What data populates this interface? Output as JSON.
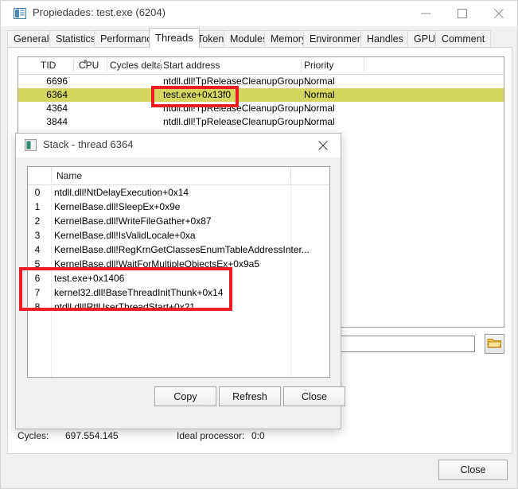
{
  "window": {
    "title": "Propiedades: test.exe (6204)",
    "icon": "properties-icon",
    "controls": {
      "minimize": "minimize-icon",
      "maximize": "maximize-icon",
      "close": "close-icon"
    }
  },
  "tabs": [
    {
      "label": "General",
      "active": false
    },
    {
      "label": "Statistics",
      "active": false
    },
    {
      "label": "Performance",
      "active": false
    },
    {
      "label": "Threads",
      "active": true
    },
    {
      "label": "Token",
      "active": false
    },
    {
      "label": "Modules",
      "active": false
    },
    {
      "label": "Memory",
      "active": false
    },
    {
      "label": "Environment",
      "active": false
    },
    {
      "label": "Handles",
      "active": false
    },
    {
      "label": "GPU",
      "active": false
    },
    {
      "label": "Comment",
      "active": false
    }
  ],
  "threads": {
    "columns": [
      "TID",
      "CPU",
      "Cycles delta",
      "Start address",
      "Priority"
    ],
    "sort_column": "CPU",
    "sort_indicator": "chevron-down-icon",
    "selected_tid": "6364",
    "selection_color": "#d6d65e",
    "rows": [
      {
        "tid": "6696",
        "cpu": "",
        "cycles_delta": "",
        "start_address": "ntdll.dll!TpReleaseCleanupGroup...",
        "priority": "Normal",
        "selected": false
      },
      {
        "tid": "6364",
        "cpu": "",
        "cycles_delta": "",
        "start_address": "test.exe+0x13f0",
        "priority": "Normal",
        "selected": true
      },
      {
        "tid": "4364",
        "cpu": "",
        "cycles_delta": "",
        "start_address": "ntdll.dll!TpReleaseCleanupGroup...",
        "priority": "Normal",
        "selected": false
      },
      {
        "tid": "3844",
        "cpu": "",
        "cycles_delta": "",
        "start_address": "ntdll.dll!TpReleaseCleanupGroup...",
        "priority": "Normal",
        "selected": false
      }
    ]
  },
  "filter": {
    "value": "",
    "placeholder": "",
    "browse_icon": "folder-icon"
  },
  "status": {
    "cycles_label": "Cycles:",
    "cycles_value": "697.554.145",
    "ideal_processor_label": "Ideal processor:",
    "ideal_processor_value": "0:0"
  },
  "main_close_label": "Close",
  "stack_dialog": {
    "title": "Stack - thread 6364",
    "icon": "stack-window-icon",
    "close_icon": "close-icon",
    "columns": [
      "",
      "Name",
      ""
    ],
    "name_header": "Name",
    "frames": [
      {
        "index": "0",
        "name": "ntdll.dll!NtDelayExecution+0x14"
      },
      {
        "index": "1",
        "name": "KernelBase.dll!SleepEx+0x9e"
      },
      {
        "index": "2",
        "name": "KernelBase.dll!WriteFileGather+0x87"
      },
      {
        "index": "3",
        "name": "KernelBase.dll!IsValidLocale+0xa"
      },
      {
        "index": "4",
        "name": "KernelBase.dll!RegKrnGetClassesEnumTableAddressInter..."
      },
      {
        "index": "5",
        "name": "KernelBase.dll!WaitForMultipleObjectsEx+0x9a5"
      },
      {
        "index": "6",
        "name": "test.exe+0x1406"
      },
      {
        "index": "7",
        "name": "kernel32.dll!BaseThreadInitThunk+0x14"
      },
      {
        "index": "8",
        "name": "ntdll.dll!RtlUserThreadStart+0x21"
      }
    ],
    "buttons": {
      "copy": "Copy",
      "refresh": "Refresh",
      "close": "Close"
    }
  },
  "annotations": {
    "color": "#ee1c25",
    "boxes": [
      {
        "name": "start-address-highlight",
        "target": "test.exe+0x13f0"
      },
      {
        "name": "stack-frames-highlight",
        "target": "frames 6-8"
      }
    ]
  }
}
